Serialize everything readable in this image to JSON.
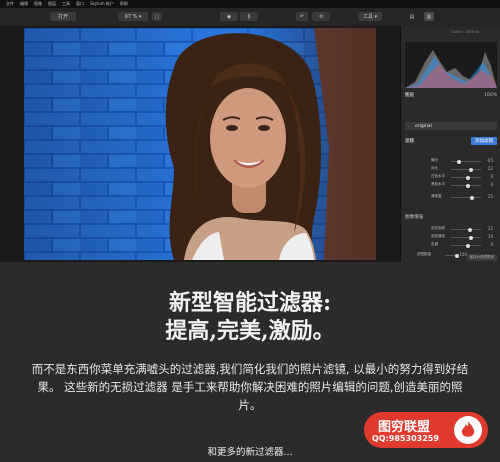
{
  "menu": [
    "文件",
    "编辑",
    "图像",
    "图层",
    "工具",
    "窗口",
    "Skylum 帐户",
    "帮助"
  ],
  "toolbar": {
    "open_label": "打开",
    "zoom_label": "97 % ▾",
    "tools_label": "工具 ▾"
  },
  "panel": {
    "histogram_info": "1440 × 1920 px",
    "layers_label": "图层",
    "layers_value": "100%",
    "layer_name": "original",
    "filters_label": "滤镜",
    "filters_button": "添加滤镜",
    "section2_label": "图像增强",
    "section3_label": "智能过滤器",
    "footer_button": "保存为滤镜预设",
    "sliders": [
      {
        "label": "曝光",
        "value": "-65"
      },
      {
        "label": "对比",
        "value": "22"
      },
      {
        "label": "白色水平",
        "value": "0"
      },
      {
        "label": "黑色水平",
        "value": "0"
      },
      {
        "label": "清晰度",
        "value": "25"
      },
      {
        "label": "色彩饱和",
        "value": "12"
      },
      {
        "label": "色彩增强",
        "value": "19"
      },
      {
        "label": "色调",
        "value": "0"
      },
      {
        "label": "滤镜数量",
        "value": "100"
      }
    ]
  },
  "marketing": {
    "headline_line1": "新型智能过滤器:",
    "headline_line2": "提高,完美,激励。",
    "body_text": "而不是东西你菜单充满嘘头的过滤器,我们简化我们的照片滤镜, 以最小的努力得到好结果。 这些新的无损过滤器 是手工来帮助你解决困难的照片编辑的问题,创造美丽的照片。",
    "more_text": "和更多的新过滤器..."
  },
  "watermark": {
    "title": "图穷联盟",
    "qq": "QQ:985303259"
  },
  "colors": {
    "wall_blue": "#1f6fd6",
    "accent_button": "#3d7bd8",
    "watermark_red": "#e0392e"
  }
}
